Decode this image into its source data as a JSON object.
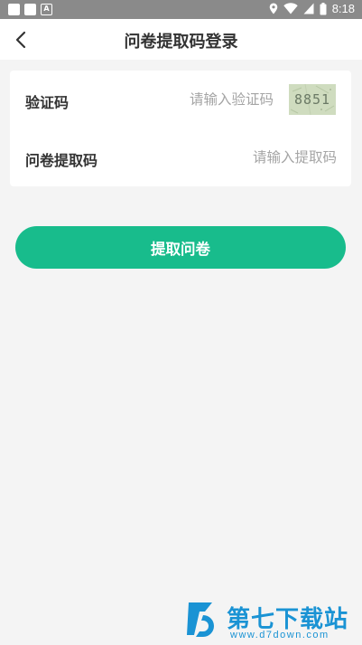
{
  "status_bar": {
    "time": "8:18",
    "left_icons": [
      "notification-square-icon",
      "notification-square-icon",
      "a-badge-icon"
    ],
    "a_badge": "A",
    "right_icons": [
      "location-icon",
      "wifi-icon",
      "signal-icon",
      "battery-icon"
    ]
  },
  "header": {
    "title": "问卷提取码登录",
    "back_icon": "chevron-left-icon"
  },
  "form": {
    "captcha_label": "验证码",
    "captcha_placeholder": "请输入验证码",
    "captcha_value": "",
    "captcha_image_text": "8851",
    "code_label": "问卷提取码",
    "code_placeholder": "请输入提取码",
    "code_value": ""
  },
  "actions": {
    "submit_label": "提取问卷"
  },
  "watermark": {
    "brand": "第七下载站",
    "url": "www.d7down.com"
  },
  "colors": {
    "accent": "#18bc8c",
    "background": "#f4f4f4",
    "status_bar": "#8a8a8a",
    "watermark": "#1a93d4"
  }
}
